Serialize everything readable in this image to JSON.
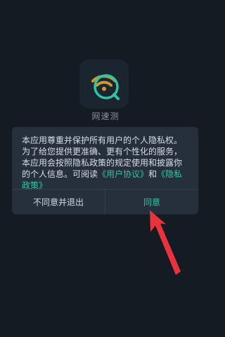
{
  "app": {
    "name": "网速测",
    "icon": "wifi-search-icon",
    "accent": "#2fc5a3",
    "icon_colors": {
      "wifi": "#c89a2e",
      "lens": "#2fc5a3"
    }
  },
  "privacy_dialog": {
    "text_before": "本应用尊重并保护所有用户的个人隐私权。为了给您提供更准确、更有个性化的服务，本应用会按照隐私政策的规定使用和披露你的个人信息。可阅读",
    "user_agreement_link": "《用户协议》",
    "connector": "和",
    "privacy_policy_link": "《隐私政策》",
    "decline_label": "不同意并退出",
    "agree_label": "同意"
  },
  "annotation": {
    "arrow_color": "#e8323c",
    "icon": "red-arrow-pointer"
  }
}
